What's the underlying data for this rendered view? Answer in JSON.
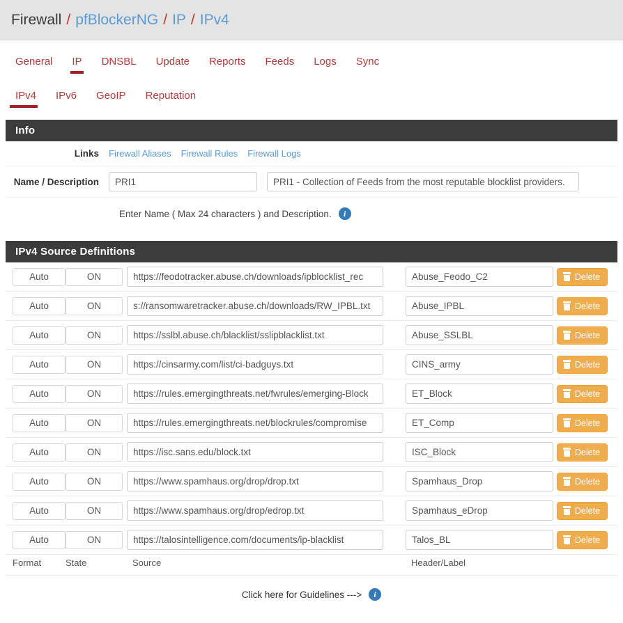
{
  "breadcrumb": {
    "root": "Firewall",
    "sep": "/",
    "items": [
      "pfBlockerNG",
      "IP",
      "IPv4"
    ]
  },
  "nav_tabs": [
    {
      "label": "General",
      "active": false
    },
    {
      "label": "IP",
      "active": true
    },
    {
      "label": "DNSBL",
      "active": false
    },
    {
      "label": "Update",
      "active": false
    },
    {
      "label": "Reports",
      "active": false
    },
    {
      "label": "Feeds",
      "active": false
    },
    {
      "label": "Logs",
      "active": false
    },
    {
      "label": "Sync",
      "active": false
    }
  ],
  "sub_tabs": [
    {
      "label": "IPv4",
      "active": true
    },
    {
      "label": "IPv6",
      "active": false
    },
    {
      "label": "GeoIP",
      "active": false
    },
    {
      "label": "Reputation",
      "active": false
    }
  ],
  "info_panel": {
    "title": "Info",
    "links_label": "Links",
    "links": [
      "Firewall Aliases",
      "Firewall Rules",
      "Firewall Logs"
    ],
    "name_desc_label": "Name / Description",
    "name_value": "PRI1",
    "name_placeholder": "Name",
    "description_value": "PRI1 - Collection of Feeds from the most reputable blocklist providers.",
    "description_placeholder": "Description",
    "helper_text": "Enter Name ( Max 24 characters ) and Description.",
    "info_icon": "info-icon",
    "info_glyph": "i"
  },
  "source_panel": {
    "title": "IPv4 Source Definitions",
    "columns": {
      "format": "Format",
      "state": "State",
      "source": "Source",
      "header": "Header/Label"
    },
    "delete_label": "Delete",
    "delete_icon": "trash-icon",
    "format_options": [
      "Auto"
    ],
    "state_options": [
      "ON"
    ],
    "rows": [
      {
        "format": "Auto",
        "state": "ON",
        "source": "https://feodotracker.abuse.ch/downloads/ipblocklist_rec",
        "header": "Abuse_Feodo_C2"
      },
      {
        "format": "Auto",
        "state": "ON",
        "source": "s://ransomwaretracker.abuse.ch/downloads/RW_IPBL.txt",
        "header": "Abuse_IPBL"
      },
      {
        "format": "Auto",
        "state": "ON",
        "source": "https://sslbl.abuse.ch/blacklist/sslipblacklist.txt",
        "header": "Abuse_SSLBL"
      },
      {
        "format": "Auto",
        "state": "ON",
        "source": "https://cinsarmy.com/list/ci-badguys.txt",
        "header": "CINS_army"
      },
      {
        "format": "Auto",
        "state": "ON",
        "source": "https://rules.emergingthreats.net/fwrules/emerging-Block",
        "header": "ET_Block"
      },
      {
        "format": "Auto",
        "state": "ON",
        "source": "https://rules.emergingthreats.net/blockrules/compromise",
        "header": "ET_Comp"
      },
      {
        "format": "Auto",
        "state": "ON",
        "source": "https://isc.sans.edu/block.txt",
        "header": "ISC_Block"
      },
      {
        "format": "Auto",
        "state": "ON",
        "source": "https://www.spamhaus.org/drop/drop.txt",
        "header": "Spamhaus_Drop"
      },
      {
        "format": "Auto",
        "state": "ON",
        "source": "https://www.spamhaus.org/drop/edrop.txt",
        "header": "Spamhaus_eDrop"
      },
      {
        "format": "Auto",
        "state": "ON",
        "source": "https://talosintelligence.com/documents/ip-blacklist",
        "header": "Talos_BL"
      }
    ],
    "guidelines_text": "Click here for Guidelines --->",
    "guidelines_icon": "info-icon",
    "guidelines_glyph": "i"
  },
  "colors": {
    "breadcrumb_bg": "#e4e4e4",
    "link_blue": "#5b9bd5",
    "tab_red": "#b33a3a",
    "tab_underline": "#a02222",
    "panel_header_bg": "#3c3c3c",
    "delete_orange": "#f0ad4e",
    "info_blue": "#337ab7"
  }
}
